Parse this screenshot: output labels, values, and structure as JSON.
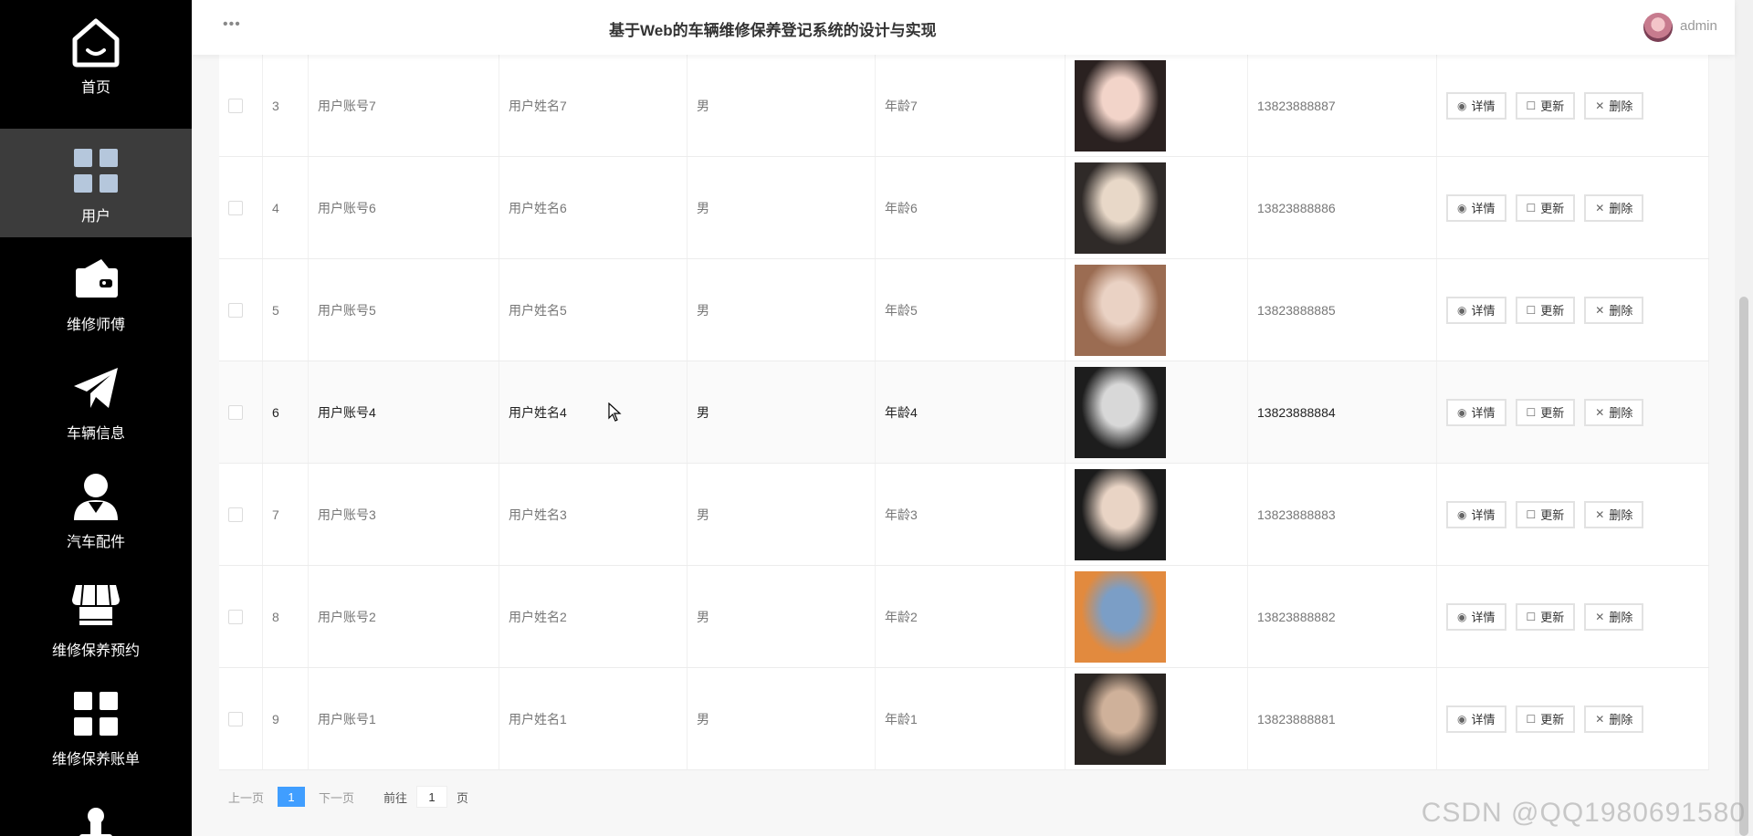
{
  "sidebar": {
    "items": [
      {
        "label": "首页",
        "icon": "home-icon"
      },
      {
        "label": "用户",
        "icon": "grid-icon"
      },
      {
        "label": "维修师傅",
        "icon": "wallet-icon"
      },
      {
        "label": "车辆信息",
        "icon": "paper-plane-icon"
      },
      {
        "label": "汽车配件",
        "icon": "person-icon"
      },
      {
        "label": "维修保养预约",
        "icon": "store-icon"
      },
      {
        "label": "维修保养账单",
        "icon": "grid-icon"
      }
    ],
    "active_index": 1
  },
  "header": {
    "menu_dots": "•••",
    "title": "基于Web的车辆维修保养登记系统的设计与实现",
    "username": "admin"
  },
  "table": {
    "rows": [
      {
        "index": "3",
        "account": "用户账号7",
        "name": "用户姓名7",
        "gender": "男",
        "age": "年龄7",
        "phone": "13823888887",
        "photo_colors": [
          "#f2d4c9",
          "#2a2120"
        ]
      },
      {
        "index": "4",
        "account": "用户账号6",
        "name": "用户姓名6",
        "gender": "男",
        "age": "年龄6",
        "phone": "13823888886",
        "photo_colors": [
          "#e8d8c8",
          "#2f2a28"
        ]
      },
      {
        "index": "5",
        "account": "用户账号5",
        "name": "用户姓名5",
        "gender": "男",
        "age": "年龄5",
        "phone": "13823888885",
        "photo_colors": [
          "#ead2c4",
          "#9b6c52"
        ]
      },
      {
        "index": "6",
        "account": "用户账号4",
        "name": "用户姓名4",
        "gender": "男",
        "age": "年龄4",
        "phone": "13823888884",
        "photo_colors": [
          "#d8d8d8",
          "#1d1d1d"
        ]
      },
      {
        "index": "7",
        "account": "用户账号3",
        "name": "用户姓名3",
        "gender": "男",
        "age": "年龄3",
        "phone": "13823888883",
        "photo_colors": [
          "#e9d4c5",
          "#1b1b1b"
        ]
      },
      {
        "index": "8",
        "account": "用户账号2",
        "name": "用户姓名2",
        "gender": "男",
        "age": "年龄2",
        "phone": "13823888882",
        "photo_colors": [
          "#7b9ec6",
          "#e28a3e"
        ]
      },
      {
        "index": "9",
        "account": "用户账号1",
        "name": "用户姓名1",
        "gender": "男",
        "age": "年龄1",
        "phone": "13823888881",
        "photo_colors": [
          "#cfb19a",
          "#2a2522"
        ]
      }
    ],
    "hovered_row_index": 3,
    "actions": {
      "detail": {
        "label": "详情",
        "icon": "eye-icon"
      },
      "update": {
        "label": "更新",
        "icon": "edit-icon"
      },
      "delete": {
        "label": "删除",
        "icon": "close-icon"
      }
    }
  },
  "pagination": {
    "prev": "上一页",
    "current": "1",
    "next": "下一页",
    "goto_prefix": "前往",
    "goto_value": "1",
    "goto_suffix": "页"
  },
  "watermark": "CSDN @QQ1980691580",
  "colors": {
    "sidebar_bg": "#000000",
    "active_bg": "#3c3c3c",
    "accent": "#409eff"
  }
}
